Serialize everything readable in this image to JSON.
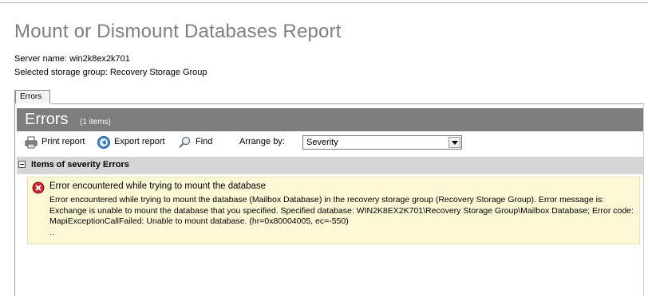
{
  "report": {
    "title": "Mount or Dismount Databases Report",
    "server_line": "Server name: win2k8ex2k701",
    "storage_line": "Selected storage group: Recovery Storage Group"
  },
  "tabs": [
    {
      "label": "Errors",
      "selected": true
    }
  ],
  "banner": {
    "title": "Errors",
    "count": "(1 items)"
  },
  "toolbar": {
    "print_label": "Print report",
    "export_label": "Export report",
    "find_label": "Find",
    "arrange_label": "Arrange by:",
    "arrange_value": "Severity"
  },
  "group": {
    "title": "Items of severity Errors",
    "expanded": true
  },
  "error_item": {
    "heading": "Error encountered while trying to mount the database",
    "body": "Error encountered while trying to mount the database (Mailbox Database) in the recovery storage group (Recovery Storage Group). Error message is: Exchange is unable to mount the database that you specified. Specified database: WIN2K8EX2K701\\Recovery Storage Group\\Mailbox Database; Error code: MapiExceptionCallFailed: Unable to mount database. (hr=0x80004005, ec=-550)",
    "more": ".."
  },
  "icons": {
    "print": "printer-icon",
    "export": "export-icon",
    "find": "magnifier-icon",
    "error": "error-icon",
    "collapse": "collapse-icon"
  },
  "colors": {
    "title_gray": "#7f7f7f",
    "banner_bg": "#7d7d7d",
    "group_bg": "#d6d6d6",
    "item_bg": "#fdf8d6",
    "error_red": "#c8252b"
  }
}
